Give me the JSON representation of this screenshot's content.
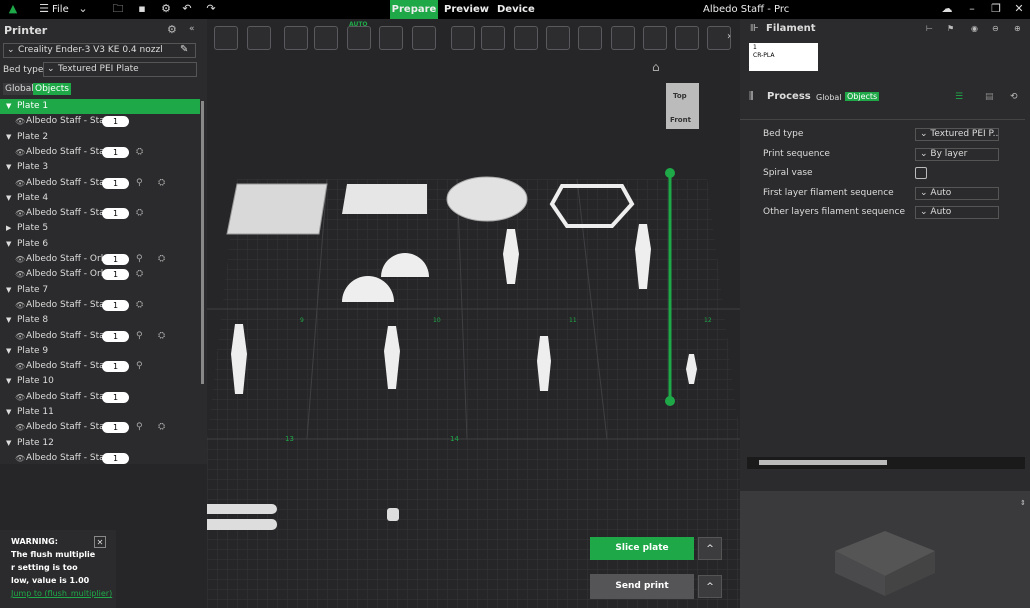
{
  "menubar": {
    "file_label": "File",
    "tabs": [
      "Prepare",
      "Preview",
      "Device"
    ],
    "window_title": "Albedo Staff - Prc"
  },
  "printer": {
    "title": "Printer",
    "printer_name": "Creality Ender-3 V3 KE 0.4 nozzl",
    "bed_type_label": "Bed type",
    "bed_type_value": "Textured PEI Plate",
    "tabs": [
      "Global",
      "Objects"
    ]
  },
  "plates": [
    {
      "label": "Plate 1",
      "objects": [
        {
          "name": "Albedo Staff - Sta",
          "qty": "1",
          "icons": []
        }
      ]
    },
    {
      "label": "Plate 2",
      "objects": [
        {
          "name": "Albedo Staff - Sta",
          "qty": "1",
          "icons": [
            "paint-icon"
          ]
        }
      ]
    },
    {
      "label": "Plate 3",
      "objects": [
        {
          "name": "Albedo Staff - Sta",
          "qty": "1",
          "icons": [
            "support-icon",
            "paint-icon"
          ]
        }
      ]
    },
    {
      "label": "Plate 4",
      "objects": [
        {
          "name": "Albedo Staff - Sta",
          "qty": "1",
          "icons": [
            "paint-icon"
          ]
        }
      ]
    },
    {
      "label": "Plate 5",
      "objects": []
    },
    {
      "label": "Plate 6",
      "objects": [
        {
          "name": "Albedo Staff - Orb",
          "qty": "1",
          "icons": [
            "support-icon",
            "paint-icon"
          ]
        },
        {
          "name": "Albedo Staff - Orb",
          "qty": "1",
          "icons": [
            "paint-icon"
          ]
        }
      ]
    },
    {
      "label": "Plate 7",
      "objects": [
        {
          "name": "Albedo Staff - Sta",
          "qty": "1",
          "icons": [
            "paint-icon"
          ]
        }
      ]
    },
    {
      "label": "Plate 8",
      "objects": [
        {
          "name": "Albedo Staff - Sta",
          "qty": "1",
          "icons": [
            "support-icon",
            "paint-icon"
          ]
        }
      ]
    },
    {
      "label": "Plate 9",
      "objects": [
        {
          "name": "Albedo Staff - Sta",
          "qty": "1",
          "icons": [
            "support-icon"
          ]
        }
      ]
    },
    {
      "label": "Plate 10",
      "objects": [
        {
          "name": "Albedo Staff - Sta",
          "qty": "1",
          "icons": []
        }
      ]
    },
    {
      "label": "Plate 11",
      "objects": [
        {
          "name": "Albedo Staff - Sta",
          "qty": "1",
          "icons": [
            "support-icon",
            "paint-icon"
          ]
        }
      ]
    },
    {
      "label": "Plate 12",
      "objects": [
        {
          "name": "Albedo Staff - Sta",
          "qty": "1",
          "icons": []
        }
      ]
    }
  ],
  "viewport": {
    "cube_top": "Top",
    "cube_front": "Front",
    "toolbar_auto": "AUTO",
    "plate_numbers": [
      "13",
      "14",
      "9",
      "10",
      "11",
      "12"
    ]
  },
  "filament": {
    "title": "Filament",
    "slot_number": "1",
    "slot_name": "CR-PLA"
  },
  "process": {
    "title": "Process",
    "tabs": [
      "Global",
      "Objects"
    ],
    "rows": [
      {
        "label": "Bed type",
        "value": "Textured PEI P...",
        "kind": "dropdown"
      },
      {
        "label": "Print sequence",
        "value": "By layer",
        "kind": "dropdown"
      },
      {
        "label": "Spiral vase",
        "value": "",
        "kind": "checkbox"
      },
      {
        "label": "First layer filament sequence",
        "value": "Auto",
        "kind": "dropdown"
      },
      {
        "label": "Other layers filament sequence",
        "value": "Auto",
        "kind": "dropdown"
      }
    ]
  },
  "actions": {
    "slice_label": "Slice plate",
    "send_label": "Send print",
    "more": "^"
  },
  "warning": {
    "title": "WARNING:",
    "lines": [
      "The flush multiplie",
      "r setting is too",
      "low, value is 1.00"
    ],
    "link": "Jump to (flush_multiplier)",
    "close": "✕"
  },
  "colors": {
    "accent": "#1fa848",
    "bg": "#262628",
    "panel": "#2b2b2d"
  }
}
